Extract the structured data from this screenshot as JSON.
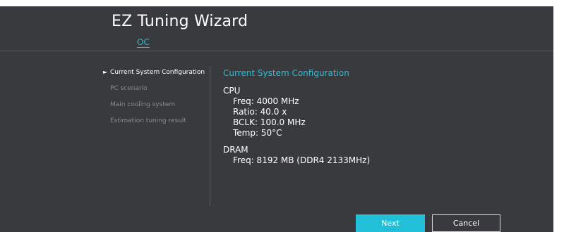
{
  "window": {
    "title": "EZ Tuning Wizard"
  },
  "tabs": [
    {
      "label": "OC",
      "active": true
    }
  ],
  "steps": [
    {
      "label": "Current System Configuration",
      "active": true
    },
    {
      "label": "PC scenario",
      "active": false
    },
    {
      "label": "Main cooling system",
      "active": false
    },
    {
      "label": "Estimation tuning result",
      "active": false
    }
  ],
  "step_marker": "►",
  "content": {
    "title": "Current System Configuration",
    "cpu": {
      "heading": "CPU",
      "items": [
        "Freq: 4000 MHz",
        "Ratio: 40.0 x",
        "BCLK: 100.0 MHz",
        "Temp: 50°C"
      ]
    },
    "dram": {
      "heading": "DRAM",
      "items": [
        "Freq: 8192 MB (DDR4 2133MHz)"
      ]
    }
  },
  "buttons": {
    "next": "Next",
    "cancel": "Cancel"
  },
  "colors": {
    "background": "#393a3d",
    "accent": "#21c0d8",
    "text": "#ffffff",
    "muted_text": "#8a8b8e"
  }
}
